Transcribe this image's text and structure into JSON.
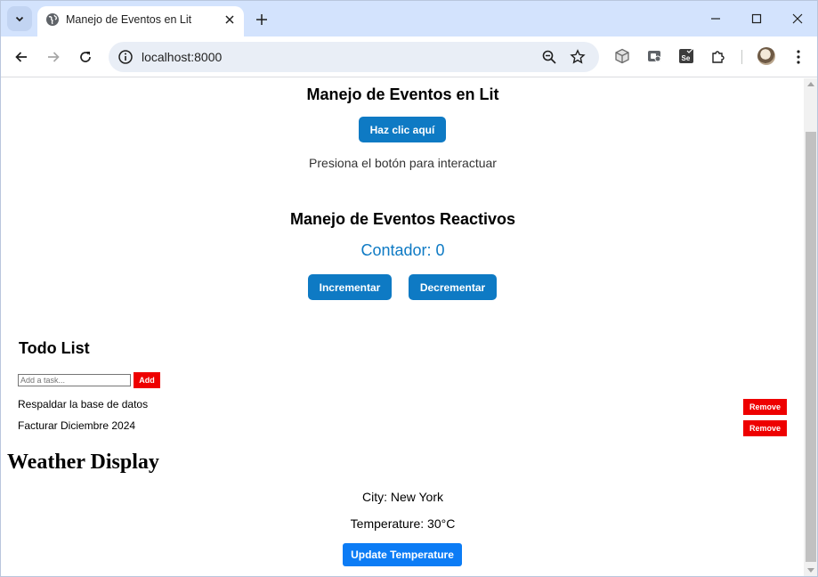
{
  "browser": {
    "tab_title": "Manejo de Eventos en Lit",
    "url": "localhost:8000"
  },
  "events": {
    "heading": "Manejo de Eventos en Lit",
    "button_label": "Haz clic aquí",
    "message": "Presiona el botón para interactuar"
  },
  "reactive": {
    "heading": "Manejo de Eventos Reactivos",
    "counter_text": "Contador: 0",
    "increment_label": "Incrementar",
    "decrement_label": "Decrementar"
  },
  "todo": {
    "heading": "Todo List",
    "input_placeholder": "Add a task...",
    "add_label": "Add",
    "remove_label": "Remove",
    "items": [
      {
        "text": "Respaldar la base de datos"
      },
      {
        "text": "Facturar Diciembre 2024"
      }
    ]
  },
  "weather": {
    "heading": "Weather Display",
    "city_text": "City: New York",
    "temperature_text": "Temperature: 30°C",
    "update_label": "Update Temperature"
  },
  "colors": {
    "accent_blue": "#0e7ac4",
    "remove_red": "#ee0000",
    "update_blue": "#0c7cf5",
    "tabstrip": "#d3e3fd"
  }
}
